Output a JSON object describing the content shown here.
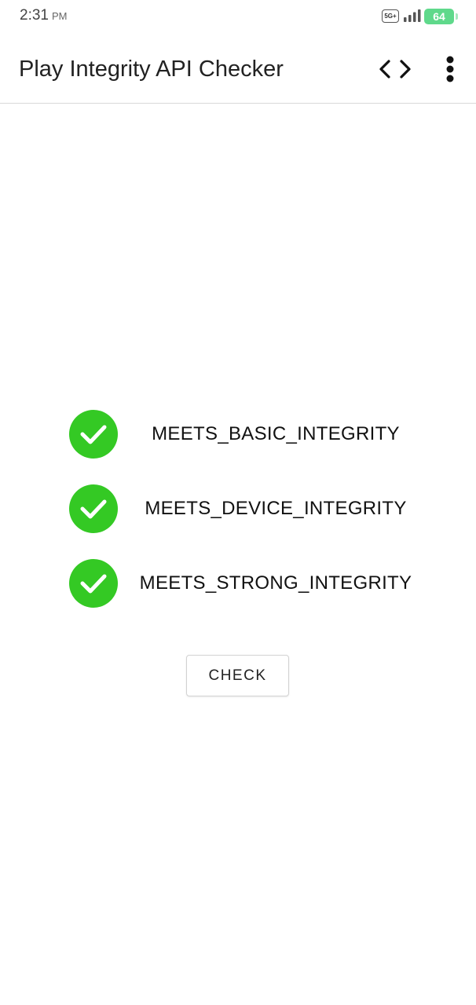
{
  "status_bar": {
    "time": "2:31",
    "ampm": "PM",
    "network": "5G+",
    "battery": "64",
    "network_icon": "network-badge-icon",
    "signal_icon": "signal-bars-icon",
    "battery_icon": "battery-icon"
  },
  "app_bar": {
    "title": "Play Integrity API Checker",
    "code_icon": "code-brackets-icon",
    "more_icon": "more-vert-icon"
  },
  "results": [
    {
      "label": "MEETS_BASIC_INTEGRITY",
      "passed": true,
      "icon": "check-circle-icon"
    },
    {
      "label": "MEETS_DEVICE_INTEGRITY",
      "passed": true,
      "icon": "check-circle-icon"
    },
    {
      "label": "MEETS_STRONG_INTEGRITY",
      "passed": true,
      "icon": "check-circle-icon"
    }
  ],
  "check_button": {
    "label": "CHECK"
  },
  "colors": {
    "pass": "#34c924",
    "battery": "#5fd98b",
    "divider": "#d9d9d9"
  }
}
